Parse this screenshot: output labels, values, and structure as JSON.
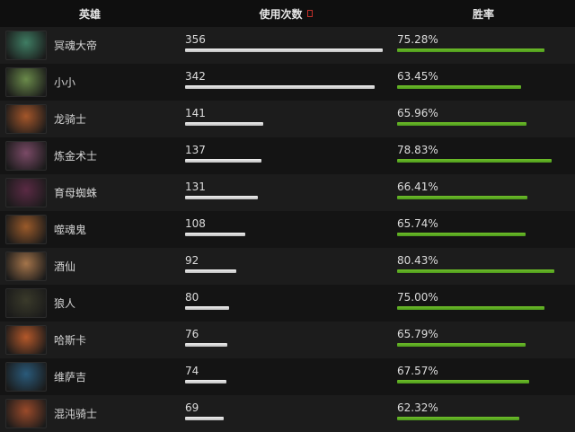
{
  "header": {
    "hero_label": "英雄",
    "uses_label": "使用次数",
    "winrate_label": "胜率"
  },
  "colors": {
    "win_bar": "#5aaa22",
    "uses_bar": "#d8d8d8",
    "sort_icon": "#c0302a"
  },
  "rows": [
    {
      "hero": "冥魂大帝",
      "uses": "356",
      "uses_value": 356,
      "winrate": "75.28%",
      "winrate_value": 75.28,
      "icon": "wraith-king-portrait-icon",
      "portrait_color": "#3f7d63"
    },
    {
      "hero": "小小",
      "uses": "342",
      "uses_value": 342,
      "winrate": "63.45%",
      "winrate_value": 63.45,
      "icon": "tiny-portrait-icon",
      "portrait_color": "#6a8a4a"
    },
    {
      "hero": "龙骑士",
      "uses": "141",
      "uses_value": 141,
      "winrate": "65.96%",
      "winrate_value": 65.96,
      "icon": "dragon-knight-portrait-icon",
      "portrait_color": "#a4562a"
    },
    {
      "hero": "炼金术士",
      "uses": "137",
      "uses_value": 137,
      "winrate": "78.83%",
      "winrate_value": 78.83,
      "icon": "alchemist-portrait-icon",
      "portrait_color": "#7a4a66"
    },
    {
      "hero": "育母蜘蛛",
      "uses": "131",
      "uses_value": 131,
      "winrate": "66.41%",
      "winrate_value": 66.41,
      "icon": "broodmother-portrait-icon",
      "portrait_color": "#5a2a44"
    },
    {
      "hero": "噬魂鬼",
      "uses": "108",
      "uses_value": 108,
      "winrate": "65.74%",
      "winrate_value": 65.74,
      "icon": "lifestealer-portrait-icon",
      "portrait_color": "#9a5a2a"
    },
    {
      "hero": "酒仙",
      "uses": "92",
      "uses_value": 92,
      "winrate": "80.43%",
      "winrate_value": 80.43,
      "icon": "brewmaster-portrait-icon",
      "portrait_color": "#a4744a"
    },
    {
      "hero": "狼人",
      "uses": "80",
      "uses_value": 80,
      "winrate": "75.00%",
      "winrate_value": 75.0,
      "icon": "lycan-portrait-icon",
      "portrait_color": "#3a3a2a"
    },
    {
      "hero": "哈斯卡",
      "uses": "76",
      "uses_value": 76,
      "winrate": "65.79%",
      "winrate_value": 65.79,
      "icon": "huskar-portrait-icon",
      "portrait_color": "#b4582a"
    },
    {
      "hero": "维萨吉",
      "uses": "74",
      "uses_value": 74,
      "winrate": "67.57%",
      "winrate_value": 67.57,
      "icon": "visage-portrait-icon",
      "portrait_color": "#2a5a7a"
    },
    {
      "hero": "混沌骑士",
      "uses": "69",
      "uses_value": 69,
      "winrate": "62.32%",
      "winrate_value": 62.32,
      "icon": "chaos-knight-portrait-icon",
      "portrait_color": "#9a4a2a"
    }
  ]
}
